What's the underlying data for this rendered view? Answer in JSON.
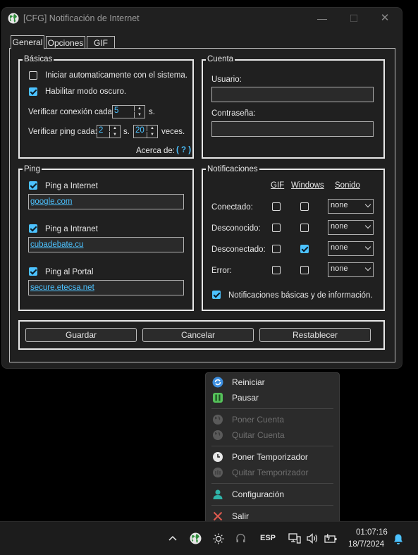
{
  "window": {
    "title": "[CFG] Notificación de Internet",
    "controls": {
      "minimize": "—",
      "maximize": "☐",
      "close": "✕"
    }
  },
  "tabs": [
    {
      "label": "General",
      "active": true
    },
    {
      "label": "Opciones",
      "active": false
    },
    {
      "label": "GIF",
      "active": false
    }
  ],
  "basicas": {
    "title": "Básicas",
    "autostart": {
      "label": "Iniciar automaticamente con el sistema.",
      "checked": false
    },
    "darkmode": {
      "label": "Habilitar modo oscuro.",
      "checked": true
    },
    "check_conn": {
      "label": "Verificar conexión cada:",
      "value": "5",
      "unit": "s."
    },
    "check_ping": {
      "label": "Verificar ping cada:",
      "value": "2",
      "unit": "s.",
      "value2": "20",
      "unit2": "veces."
    },
    "about": {
      "label": "Acerca de:",
      "link": "( ? )"
    }
  },
  "cuenta": {
    "title": "Cuenta",
    "user_label": "Usuario:",
    "user_value": "",
    "pass_label": "Contraseña:",
    "pass_value": ""
  },
  "ping": {
    "title": "Ping",
    "items": [
      {
        "label": "Ping a Internet",
        "checked": true,
        "value": "google.com"
      },
      {
        "label": "Ping a Intranet",
        "checked": true,
        "value": "cubadebate.cu"
      },
      {
        "label": "Ping al Portal",
        "checked": true,
        "value": "secure.etecsa.net"
      }
    ]
  },
  "notificaciones": {
    "title": "Notificaciones",
    "columns": [
      "GIF",
      "Windows",
      "Sonido"
    ],
    "rows": [
      {
        "label": "Conectado:",
        "gif": false,
        "windows": false,
        "sound": "none"
      },
      {
        "label": "Desconocido:",
        "gif": false,
        "windows": false,
        "sound": "none"
      },
      {
        "label": "Desconectado:",
        "gif": false,
        "windows": true,
        "sound": "none"
      },
      {
        "label": "Error:",
        "gif": false,
        "windows": false,
        "sound": "none"
      }
    ],
    "basic": {
      "label": "Notificaciones básicas y de información.",
      "checked": true
    }
  },
  "buttons": {
    "save": "Guardar",
    "cancel": "Cancelar",
    "reset": "Restablecer"
  },
  "tray_menu": {
    "items": [
      {
        "label": "Reiniciar",
        "enabled": true,
        "icon": "restart-icon"
      },
      {
        "label": "Pausar",
        "enabled": true,
        "icon": "pause-icon"
      },
      {
        "label": "Poner Cuenta",
        "enabled": false,
        "icon": "globe-icon"
      },
      {
        "label": "Quitar Cuenta",
        "enabled": false,
        "icon": "globe-icon"
      },
      {
        "label": "Poner Temporizador",
        "enabled": true,
        "icon": "clock-icon"
      },
      {
        "label": "Quitar Temporizador",
        "enabled": false,
        "icon": "timer-off-icon"
      },
      {
        "label": "Configuración",
        "enabled": true,
        "icon": "user-icon"
      },
      {
        "label": "Salir",
        "enabled": true,
        "icon": "close-icon"
      }
    ]
  },
  "taskbar": {
    "language": "ESP",
    "time": "01:07:16",
    "date": "18/7/2024"
  },
  "colors": {
    "accent": "#4cc2ff",
    "window_bg": "#202020",
    "menu_bg": "#2b2b2b",
    "exit_red": "#e05a4f",
    "pause_green": "#55c15a"
  }
}
